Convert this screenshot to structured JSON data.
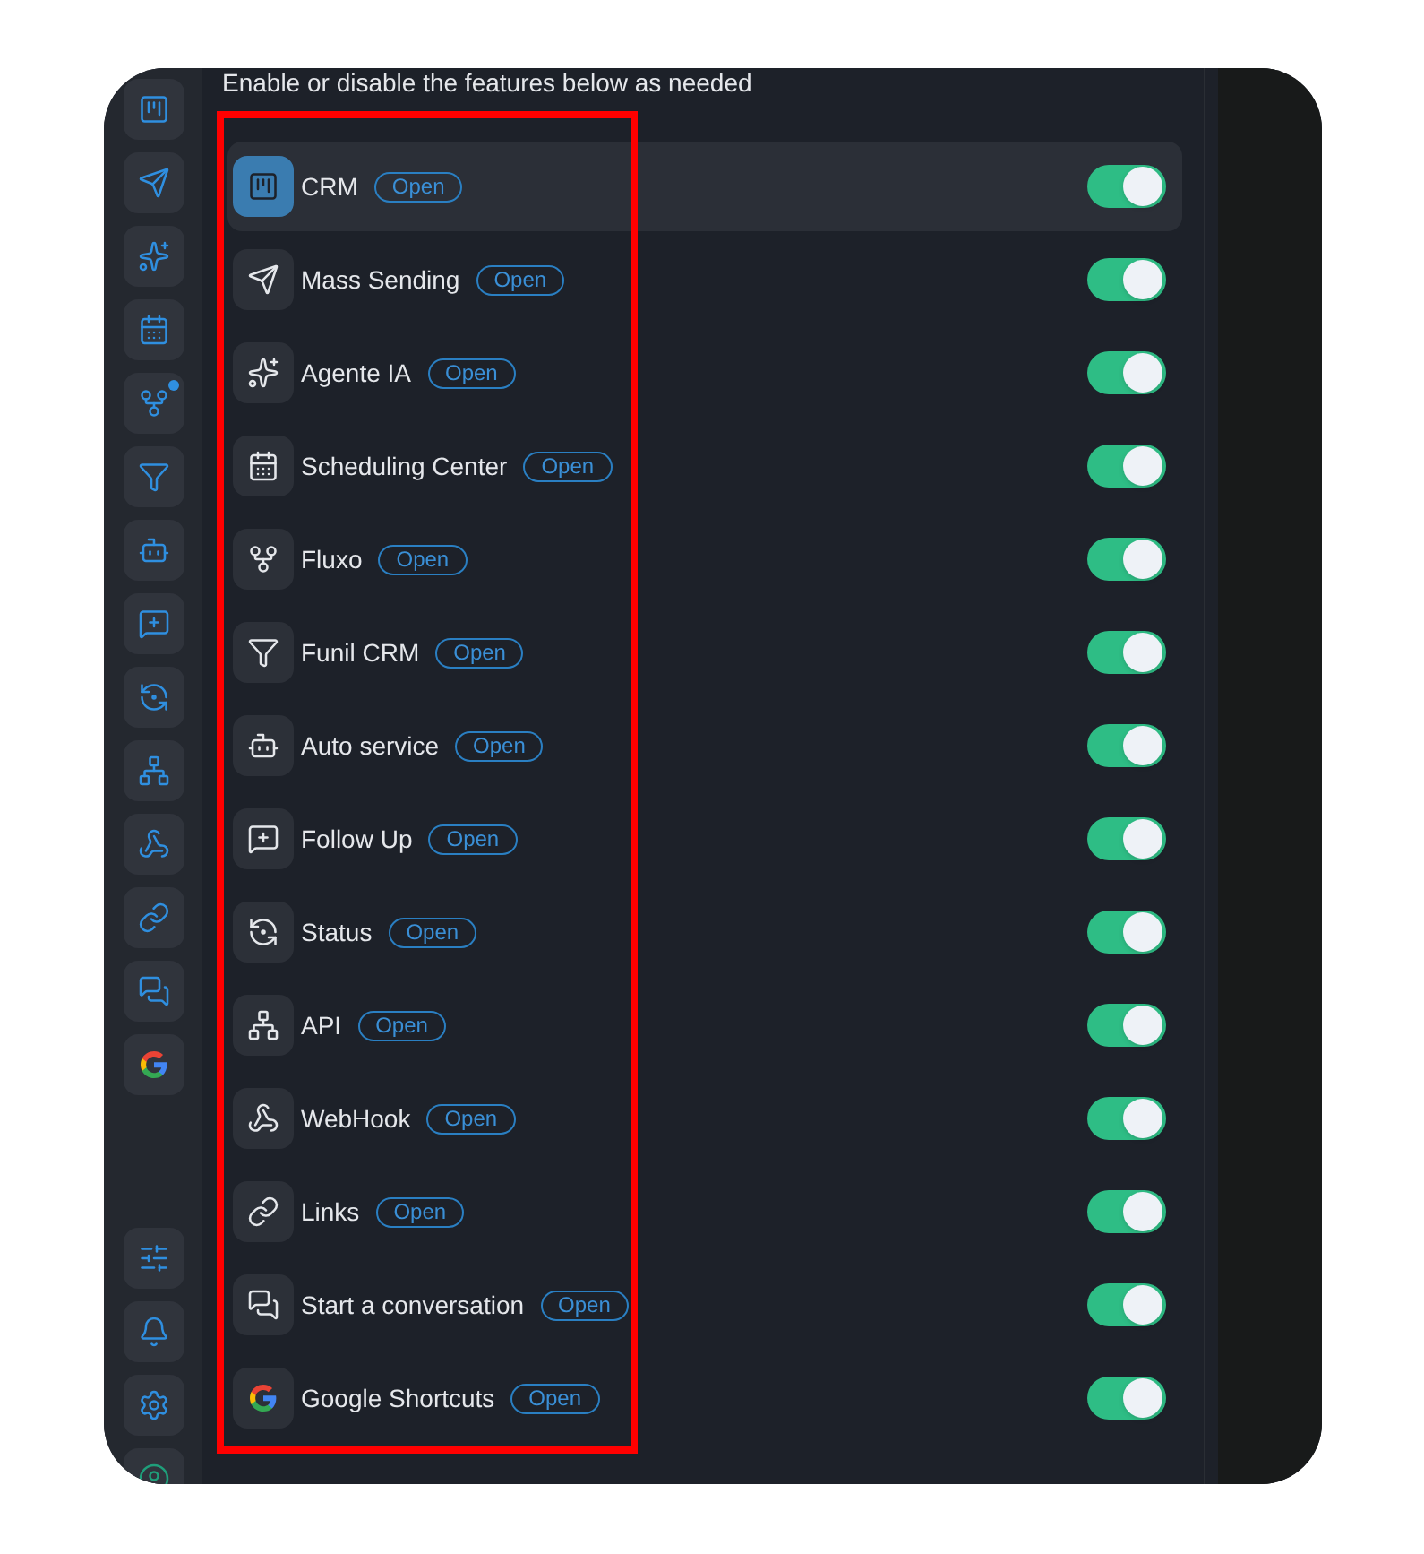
{
  "header": "Enable or disable the features below as needed",
  "sidebar": {
    "items": [
      {
        "notification_dot": false
      },
      {
        "notification_dot": false
      },
      {
        "notification_dot": false
      },
      {
        "notification_dot": false
      },
      {
        "notification_dot": true
      },
      {
        "notification_dot": false
      },
      {
        "notification_dot": false
      },
      {
        "notification_dot": false
      },
      {
        "notification_dot": false
      },
      {
        "notification_dot": false
      },
      {
        "notification_dot": false
      },
      {
        "notification_dot": false
      },
      {
        "notification_dot": false
      },
      {
        "notification_dot": false
      }
    ]
  },
  "features": [
    {
      "name": "CRM",
      "open_label": "Open",
      "enabled": true,
      "selected": true
    },
    {
      "name": "Mass Sending",
      "open_label": "Open",
      "enabled": true,
      "selected": false
    },
    {
      "name": "Agente IA",
      "open_label": "Open",
      "enabled": true,
      "selected": false
    },
    {
      "name": "Scheduling Center",
      "open_label": "Open",
      "enabled": true,
      "selected": false
    },
    {
      "name": "Fluxo",
      "open_label": "Open",
      "enabled": true,
      "selected": false
    },
    {
      "name": "Funil CRM",
      "open_label": "Open",
      "enabled": true,
      "selected": false
    },
    {
      "name": "Auto service",
      "open_label": "Open",
      "enabled": true,
      "selected": false
    },
    {
      "name": "Follow Up",
      "open_label": "Open",
      "enabled": true,
      "selected": false
    },
    {
      "name": "Status",
      "open_label": "Open",
      "enabled": true,
      "selected": false
    },
    {
      "name": "API",
      "open_label": "Open",
      "enabled": true,
      "selected": false
    },
    {
      "name": "WebHook",
      "open_label": "Open",
      "enabled": true,
      "selected": false
    },
    {
      "name": "Links",
      "open_label": "Open",
      "enabled": true,
      "selected": false
    },
    {
      "name": "Start a conversation",
      "open_label": "Open",
      "enabled": true,
      "selected": false
    },
    {
      "name": "Google Shortcuts",
      "open_label": "Open",
      "enabled": true,
      "selected": false
    }
  ]
}
